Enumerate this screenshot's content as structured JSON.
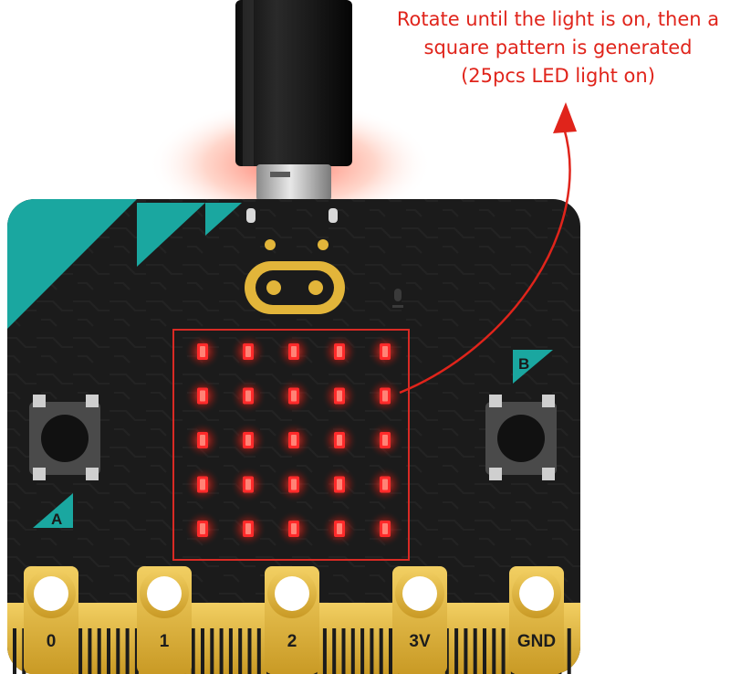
{
  "annotation": {
    "lines": [
      "Rotate until the light is on, then a",
      "square pattern is generated",
      "(25pcs LED light on)"
    ],
    "color": "#e0241b"
  },
  "board": {
    "color": "#1b1b1b",
    "accent_color": "#1aa7a0",
    "gold_color": "#e2b53a",
    "led_color": "#ff2a2a",
    "led_matrix": {
      "rows": 5,
      "cols": 5,
      "lit_count": 25
    },
    "buttons": {
      "left_label": "A",
      "right_label": "B"
    },
    "pins": [
      "0",
      "1",
      "2",
      "3V",
      "GND"
    ]
  },
  "usb_cable": {
    "icon": "usb-c-connector"
  }
}
